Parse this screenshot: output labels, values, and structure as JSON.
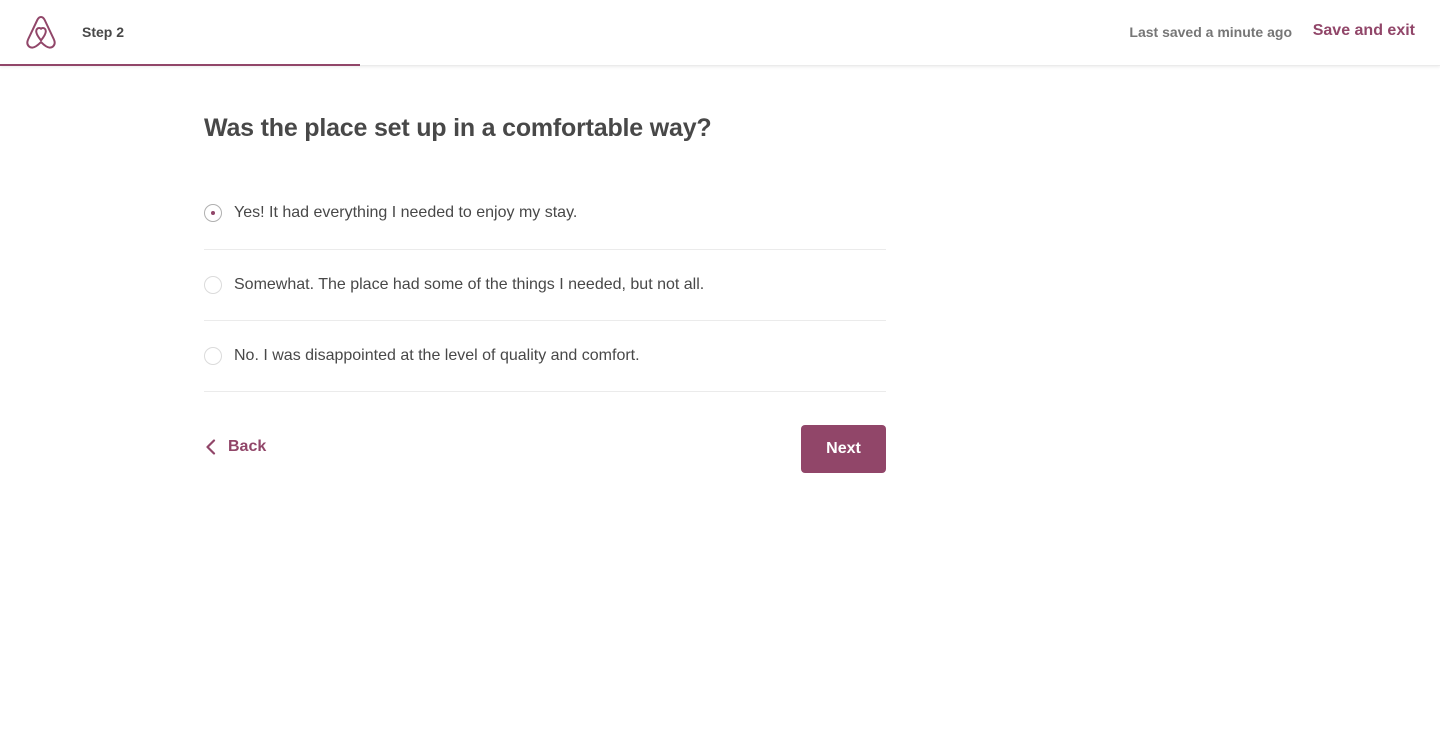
{
  "header": {
    "step_label": "Step 2",
    "saved_status": "Last saved a minute ago",
    "save_exit_label": "Save and exit",
    "logo_icon": "airbnb-logo-icon",
    "progress_fraction": 0.25
  },
  "main": {
    "question": "Was the place set up in a comfortable way?",
    "options": [
      {
        "label": "Yes! It had everything I needed to enjoy my stay.",
        "selected": true
      },
      {
        "label": "Somewhat. The place had some of the things I needed, but not all.",
        "selected": false
      },
      {
        "label": "No. I was disappointed at the level of quality and comfort.",
        "selected": false
      }
    ]
  },
  "footer": {
    "back_label": "Back",
    "back_icon": "chevron-left-icon",
    "next_label": "Next"
  },
  "colors": {
    "accent": "#914669",
    "text": "#484848",
    "muted": "#767676",
    "divider": "#ebebeb"
  }
}
